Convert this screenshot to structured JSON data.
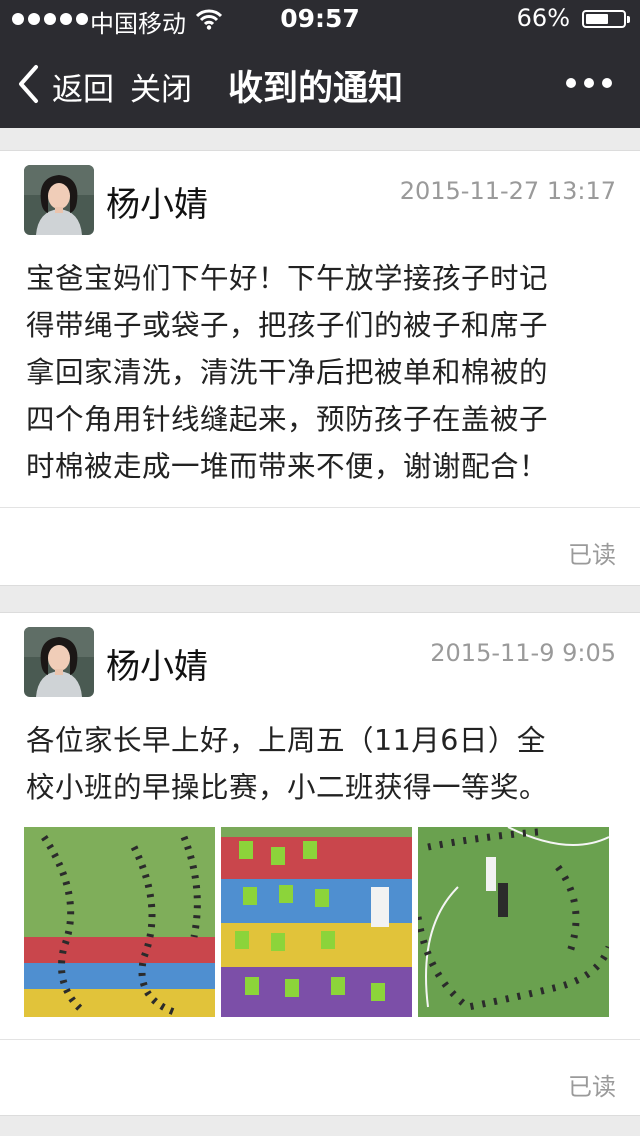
{
  "status_bar": {
    "carrier": "中国移动",
    "time": "09:57",
    "battery": "66%",
    "battery_level": 0.66
  },
  "nav": {
    "back_label": "返回",
    "close_label": "关闭",
    "title": "收到的通知"
  },
  "notifications": [
    {
      "sender": "杨小婧",
      "date": "2015-11-27 13:17",
      "lines": [
        "宝爸宝妈们下午好！下午放学接孩子时记",
        "得带绳子或袋子，把孩子们的被子和席子",
        "拿回家清洗，清洗干净后把被单和棉被的",
        "四个角用针线缝起来，预防孩子在盖被子",
        "时棉被走成一堆而带来不便，谢谢配合！"
      ],
      "status": "已读"
    },
    {
      "sender": "杨小婧",
      "date": "2015-11-9 9:05",
      "lines": [
        "各位家长早上好，上周五（11月6日）全",
        "校小班的早操比赛，小二班获得一等奖。"
      ],
      "status": "已读"
    }
  ]
}
